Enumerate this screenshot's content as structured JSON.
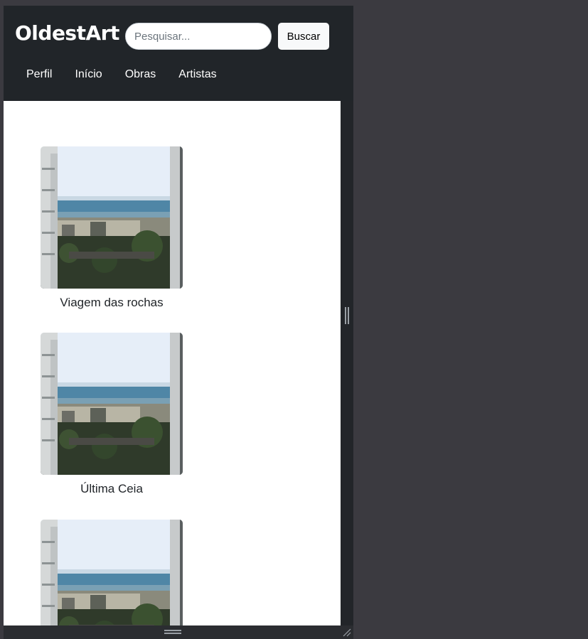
{
  "header": {
    "brand": "OldestArt",
    "search_placeholder": "Pesquisar...",
    "search_value": "",
    "search_button": "Buscar"
  },
  "nav": {
    "items": [
      {
        "label": "Perfil"
      },
      {
        "label": "Início"
      },
      {
        "label": "Obras"
      },
      {
        "label": "Artistas"
      }
    ]
  },
  "artworks": [
    {
      "title": "Viagem das rochas",
      "image": "coastal-city-photo"
    },
    {
      "title": "Última Ceia",
      "image": "coastal-city-photo"
    },
    {
      "title": "",
      "image": "coastal-city-photo"
    }
  ],
  "colors": {
    "navbar": "#212529",
    "page_background": "#3b3a40",
    "content_background": "#ffffff",
    "button_background": "#f8f9fa"
  }
}
